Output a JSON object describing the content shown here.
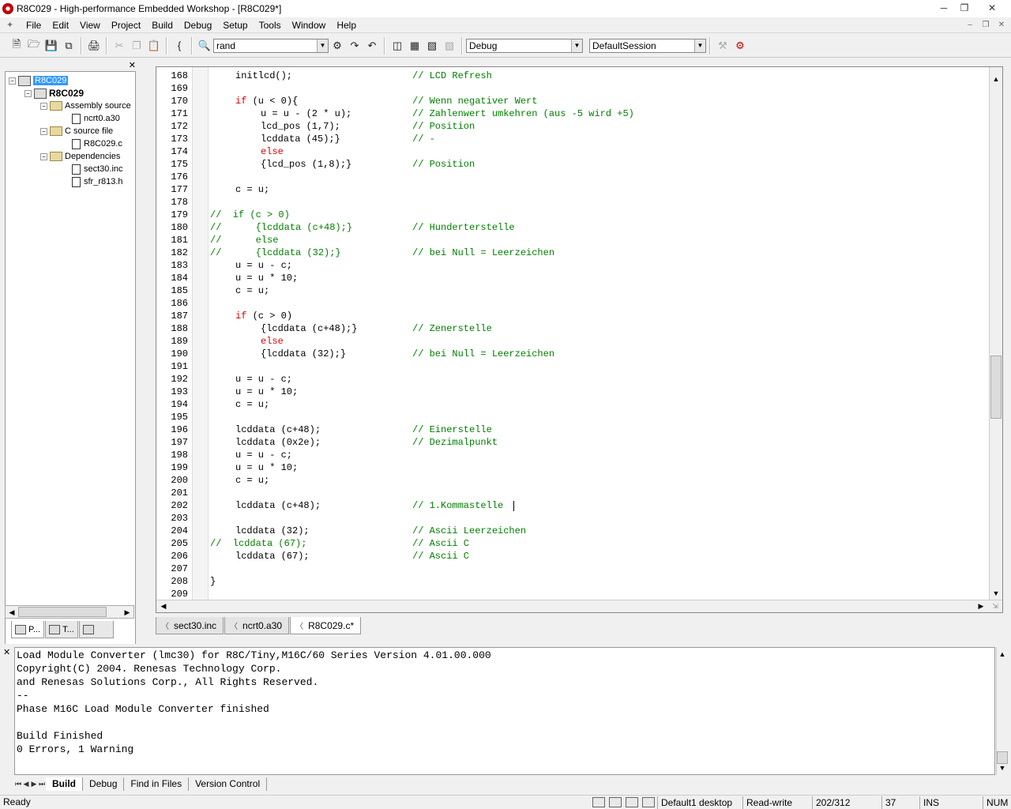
{
  "window": {
    "title": "R8C029 - High-performance Embedded Workshop - [R8C029*]"
  },
  "menu": [
    "File",
    "Edit",
    "View",
    "Project",
    "Build",
    "Debug",
    "Setup",
    "Tools",
    "Window",
    "Help"
  ],
  "toolbar": {
    "search_value": "rand",
    "config_value": "Debug",
    "session_value": "DefaultSession"
  },
  "workspace": {
    "root": "R8C029",
    "project": "R8C029",
    "folders": [
      {
        "name": "Assembly source",
        "files": [
          "ncrt0.a30"
        ]
      },
      {
        "name": "C source file",
        "files": [
          "R8C029.c"
        ]
      },
      {
        "name": "Dependencies",
        "files": [
          "sect30.inc",
          "sfr_r813.h"
        ]
      }
    ],
    "tabs": [
      "P...",
      "T...",
      ""
    ]
  },
  "editor": {
    "lines": [
      {
        "n": "168",
        "code": "initlcd();",
        "indent": 0,
        "comment": "// LCD Refresh"
      },
      {
        "n": "169",
        "code": "",
        "indent": 0,
        "comment": ""
      },
      {
        "n": "170",
        "code": "if (u < 0){",
        "indent": 0,
        "comment": "// Wenn negativer Wert"
      },
      {
        "n": "171",
        "code": "u = u - (2 * u);",
        "indent": 1,
        "comment": "// Zahlenwert umkehren (aus -5 wird +5)"
      },
      {
        "n": "172",
        "code": "lcd_pos (1,7);",
        "indent": 1,
        "comment": "// Position"
      },
      {
        "n": "173",
        "code": "lcddata (45);}",
        "indent": 1,
        "comment": "// -"
      },
      {
        "n": "174",
        "code": "else",
        "indent": 1,
        "comment": ""
      },
      {
        "n": "175",
        "code": "{lcd_pos (1,8);}",
        "indent": 1,
        "comment": "// Position"
      },
      {
        "n": "176",
        "code": "",
        "indent": 0,
        "comment": ""
      },
      {
        "n": "177",
        "code": "c = u;",
        "indent": 0,
        "comment": ""
      },
      {
        "n": "178",
        "code": "",
        "indent": 0,
        "comment": ""
      },
      {
        "n": "179",
        "code": "//  if (c > 0)",
        "indent": -1,
        "comment": ""
      },
      {
        "n": "180",
        "code": "//      {lcddata (c+48);}",
        "indent": -1,
        "comment": "// Hunderterstelle"
      },
      {
        "n": "181",
        "code": "//      else",
        "indent": -1,
        "comment": ""
      },
      {
        "n": "182",
        "code": "//      {lcddata (32);}",
        "indent": -1,
        "comment": "// bei Null = Leerzeichen"
      },
      {
        "n": "183",
        "code": "u = u - c;",
        "indent": 0,
        "comment": ""
      },
      {
        "n": "184",
        "code": "u = u * 10;",
        "indent": 0,
        "comment": ""
      },
      {
        "n": "185",
        "code": "c = u;",
        "indent": 0,
        "comment": ""
      },
      {
        "n": "186",
        "code": "",
        "indent": 0,
        "comment": ""
      },
      {
        "n": "187",
        "code": "if (c > 0)",
        "indent": 0,
        "comment": ""
      },
      {
        "n": "188",
        "code": "{lcddata (c+48);}",
        "indent": 1,
        "comment": "// Zenerstelle"
      },
      {
        "n": "189",
        "code": "else",
        "indent": 1,
        "comment": ""
      },
      {
        "n": "190",
        "code": "{lcddata (32);}",
        "indent": 1,
        "comment": "// bei Null = Leerzeichen"
      },
      {
        "n": "191",
        "code": "",
        "indent": 0,
        "comment": ""
      },
      {
        "n": "192",
        "code": "u = u - c;",
        "indent": 0,
        "comment": ""
      },
      {
        "n": "193",
        "code": "u = u * 10;",
        "indent": 0,
        "comment": ""
      },
      {
        "n": "194",
        "code": "c = u;",
        "indent": 0,
        "comment": ""
      },
      {
        "n": "195",
        "code": "",
        "indent": 0,
        "comment": ""
      },
      {
        "n": "196",
        "code": "lcddata (c+48);",
        "indent": 0,
        "comment": "// Einerstelle"
      },
      {
        "n": "197",
        "code": "lcddata (0x2e);",
        "indent": 0,
        "comment": "// Dezimalpunkt"
      },
      {
        "n": "198",
        "code": "u = u - c;",
        "indent": 0,
        "comment": ""
      },
      {
        "n": "199",
        "code": "u = u * 10;",
        "indent": 0,
        "comment": ""
      },
      {
        "n": "200",
        "code": "c = u;",
        "indent": 0,
        "comment": ""
      },
      {
        "n": "201",
        "code": "",
        "indent": 0,
        "comment": ""
      },
      {
        "n": "202",
        "code": "lcddata (c+48);",
        "indent": 0,
        "comment": "// 1.Kommastelle"
      },
      {
        "n": "203",
        "code": "",
        "indent": 0,
        "comment": ""
      },
      {
        "n": "204",
        "code": "lcddata (32);",
        "indent": 0,
        "comment": "// Ascii Leerzeichen"
      },
      {
        "n": "205",
        "code": "//  lcddata (67);",
        "indent": -1,
        "comment": "// Ascii C"
      },
      {
        "n": "206",
        "code": "lcddata (67);",
        "indent": 0,
        "comment": "// Ascii C"
      },
      {
        "n": "207",
        "code": "",
        "indent": 0,
        "comment": ""
      },
      {
        "n": "208",
        "code": "}",
        "indent": -2,
        "comment": ""
      },
      {
        "n": "209",
        "code": "",
        "indent": 0,
        "comment": ""
      }
    ],
    "keyword_color": "#dd0000",
    "comment_color": "#008000"
  },
  "file_tabs": [
    "sect30.inc",
    "ncrt0.a30",
    "R8C029.c*"
  ],
  "output": {
    "lines": [
      "Load Module Converter (lmc30) for R8C/Tiny,M16C/60 Series Version 4.01.00.000",
      "Copyright(C) 2004. Renesas Technology Corp.",
      "and Renesas Solutions Corp., All Rights Reserved.",
      "--",
      "Phase M16C Load Module Converter finished",
      "",
      "Build Finished",
      "0 Errors, 1 Warning"
    ],
    "tabs": [
      "Build",
      "Debug",
      "Find in Files",
      "Version Control"
    ]
  },
  "status": {
    "ready": "Ready",
    "desktop": "Default1 desktop",
    "mode": "Read-write",
    "position": "202/312",
    "column": "37",
    "ins": "INS",
    "num": "NUM"
  }
}
